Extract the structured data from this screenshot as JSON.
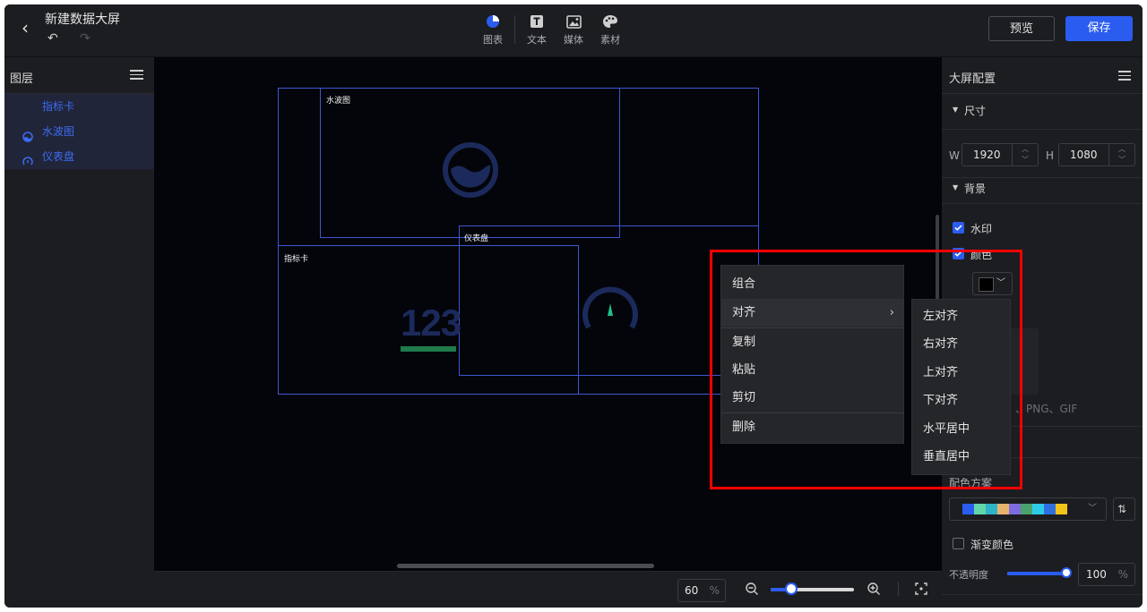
{
  "header": {
    "back_icon": "chevron-left-icon",
    "title": "新建数据大屏",
    "tools": [
      {
        "label": "图表",
        "icon": "pie-chart-icon"
      },
      {
        "label": "文本",
        "icon": "text-icon"
      },
      {
        "label": "媒体",
        "icon": "image-icon"
      },
      {
        "label": "素材",
        "icon": "palette-icon"
      }
    ],
    "preview_label": "预览",
    "save_label": "保存"
  },
  "layers_panel": {
    "title": "图层",
    "items": [
      {
        "label": "指标卡",
        "icon": ""
      },
      {
        "label": "水波图",
        "icon": "water-wave-icon"
      },
      {
        "label": "仪表盘",
        "icon": "gauge-icon"
      }
    ]
  },
  "canvas": {
    "widgets": [
      {
        "label": "水波图"
      },
      {
        "label": "仪表盘"
      },
      {
        "label": "指标卡",
        "value": "123"
      }
    ],
    "zoom_value": "60",
    "zoom_unit": "%",
    "zoom_slider_fraction": 0.25
  },
  "context_menu": {
    "items": [
      "组合",
      "对齐",
      "复制",
      "粘贴",
      "剪切",
      "删除"
    ],
    "submenu_arrow": "›",
    "align_submenu": [
      "左对齐",
      "右对齐",
      "上对齐",
      "下对齐",
      "水平居中",
      "垂直居中"
    ]
  },
  "config_panel": {
    "title": "大屏配置",
    "size_section": "尺寸",
    "w_label": "W",
    "w_value": "1920",
    "h_label": "H",
    "h_value": "1080",
    "bg_section": "背景",
    "watermark_label": "水印",
    "color_label": "颜色",
    "upload_hint": "、PNG、GIF",
    "palette_label": "配色方案",
    "palette_colors": [
      "#2b5cf0",
      "#63d6a9",
      "#2fb3c7",
      "#e7b36d",
      "#7f6be0",
      "#4aa36c",
      "#2ecbe8",
      "#2f6fe0",
      "#f2c417"
    ],
    "gradient_label": "渐变颜色",
    "opacity_label": "不透明度",
    "opacity_value": "100",
    "opacity_unit": "%",
    "opacity_fraction": 1.0
  }
}
